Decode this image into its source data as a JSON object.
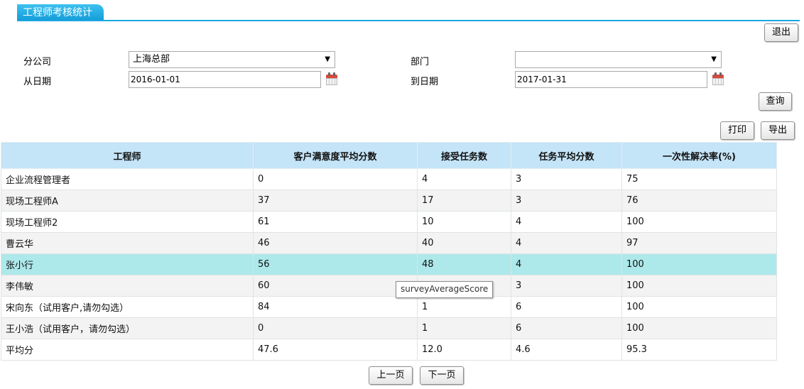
{
  "tab": {
    "title": "工程师考核统计"
  },
  "toolbar": {
    "exit": "退出",
    "query": "查询",
    "print": "打印",
    "export": "导出"
  },
  "filters": {
    "branch_label": "分公司",
    "branch_value": "上海总部",
    "dept_label": "部门",
    "dept_value": "",
    "from_label": "从日期",
    "from_value": "2016-01-01",
    "to_label": "到日期",
    "to_value": "2017-01-31"
  },
  "table": {
    "headers": [
      "工程师",
      "客户满意度平均分数",
      "接受任务数",
      "任务平均分数",
      "一次性解决率(%)"
    ],
    "rows": [
      [
        "企业流程管理者",
        "0",
        "4",
        "3",
        "75"
      ],
      [
        "现场工程师A",
        "37",
        "17",
        "3",
        "76"
      ],
      [
        "现场工程师2",
        "61",
        "10",
        "4",
        "100"
      ],
      [
        "曹云华",
        "46",
        "40",
        "4",
        "97"
      ],
      [
        "张小行",
        "56",
        "48",
        "4",
        "100"
      ],
      [
        "李伟敏",
        "60",
        "",
        "3",
        "100"
      ],
      [
        "宋向东（试用客户,请勿勾选）",
        "84",
        "1",
        "6",
        "100"
      ],
      [
        "王小浩（试用客户，请勿勾选）",
        "0",
        "1",
        "6",
        "100"
      ],
      [
        "平均分",
        "47.6",
        "12.0",
        "4.6",
        "95.3"
      ]
    ]
  },
  "tooltip": "surveyAverageScore",
  "pager": {
    "prev": "上一页",
    "next": "下一页"
  },
  "colors": {
    "accent": "#1aa7e0",
    "header_bg": "#c4e4f7",
    "selected_row": "#ade8ea"
  }
}
